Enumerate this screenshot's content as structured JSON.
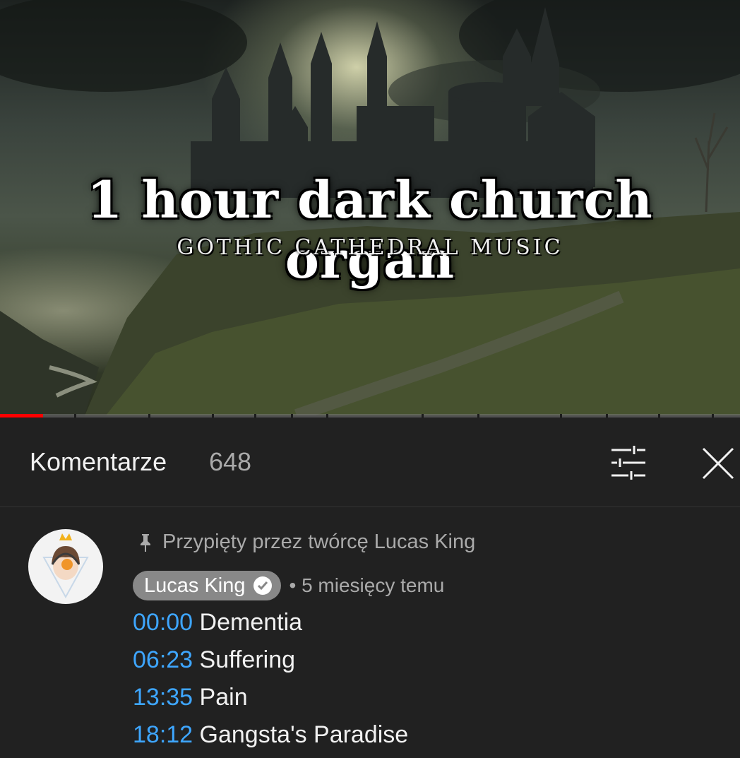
{
  "video": {
    "title_main": "1 hour dark church organ",
    "title_sub": "GOTHIC CATHEDRAL MUSIC",
    "progress": 0.058
  },
  "comments": {
    "title": "Komentarze",
    "count": "648",
    "filter_icon": "filter-sliders-icon",
    "close_icon": "close-icon"
  },
  "pinned_comment": {
    "pinned_label": "Przypięty przez twórcę Lucas King",
    "author": "Lucas King",
    "time": "• 5 miesięcy temu",
    "chapters": [
      {
        "time": "00:00",
        "title": "Dementia"
      },
      {
        "time": "06:23",
        "title": "Suffering"
      },
      {
        "time": "13:35",
        "title": "Pain"
      },
      {
        "time": "18:12",
        "title": "Gangsta's Paradise"
      }
    ]
  },
  "colors": {
    "background": "#212121",
    "timestamp": "#3ea6ff",
    "progress": "#ff0000",
    "chip": "#888888"
  }
}
